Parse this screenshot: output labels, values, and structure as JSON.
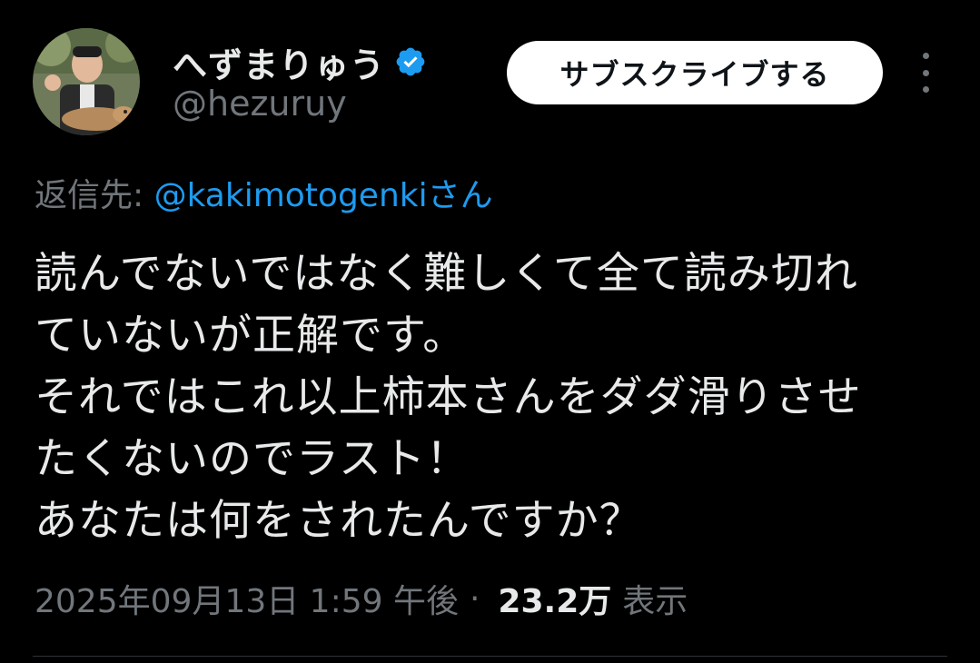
{
  "user": {
    "display_name": "へずまりゅう",
    "handle": "@hezuruy",
    "verified": true,
    "avatar_icon": "profile-photo"
  },
  "actions": {
    "subscribe_label": "サブスクライブする",
    "more_icon": "more-vertical-icon"
  },
  "reply": {
    "prefix": "返信先: ",
    "target": "@kakimotogenki",
    "suffix": "さん"
  },
  "tweet": {
    "lines": [
      "読んでないではなく難しくて全て読み切れ",
      "ていないが正解です。",
      "それではこれ以上柿本さんをダダ滑りさせ",
      "たくないのでラスト！",
      "あなたは何をされたんですか？"
    ]
  },
  "meta": {
    "timestamp": "2025年09月13日 1:59 午後",
    "separator": "·",
    "views_count": "23.2万",
    "views_label": "表示"
  },
  "colors": {
    "background": "#000000",
    "text": "#e7e9ea",
    "muted": "#71767b",
    "link": "#1d9bf0",
    "verified": "#1d9bf0"
  }
}
